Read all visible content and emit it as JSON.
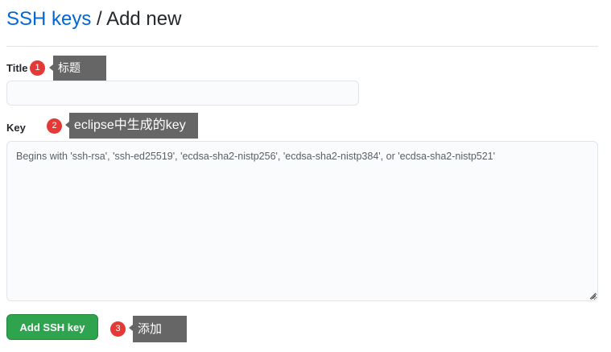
{
  "header": {
    "breadcrumb_link": "SSH keys",
    "separator": "/",
    "current": "Add new"
  },
  "form": {
    "title_label": "Title",
    "title_value": "",
    "key_label": "Key",
    "key_placeholder": "Begins with 'ssh-rsa', 'ssh-ed25519', 'ecdsa-sha2-nistp256', 'ecdsa-sha2-nistp384', or 'ecdsa-sha2-nistp521'",
    "submit_label": "Add SSH key"
  },
  "annotations": [
    {
      "number": "1",
      "text": "标题"
    },
    {
      "number": "2",
      "text": "eclipse中生成的key"
    },
    {
      "number": "3",
      "text": "添加"
    }
  ],
  "colors": {
    "link": "#0366d6",
    "primary_button": "#2ea44f",
    "badge": "#e53935",
    "callout": "#666666"
  }
}
